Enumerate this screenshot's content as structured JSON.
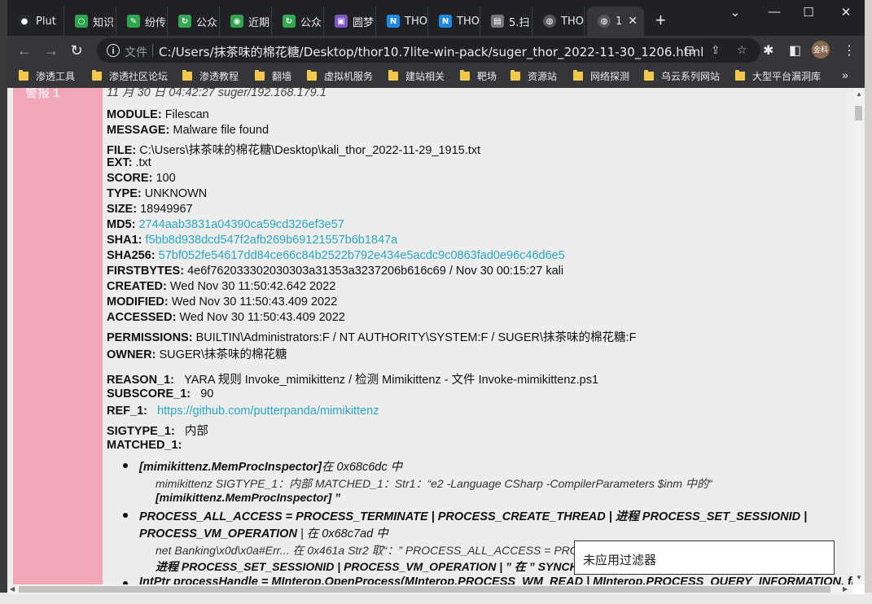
{
  "browser": {
    "tabs": [
      {
        "label": "Plut",
        "icon": "github-icon",
        "color": "#24292e"
      },
      {
        "label": "知识",
        "icon": "ring-icon",
        "color": "#2ea44f"
      },
      {
        "label": "纷传",
        "icon": "chat-icon",
        "color": "#2ea44f"
      },
      {
        "label": "公众",
        "icon": "swirl-icon",
        "color": "#34a853"
      },
      {
        "label": "近期",
        "icon": "wechat-icon",
        "color": "#2ea44f"
      },
      {
        "label": "公众",
        "icon": "swirl-icon",
        "color": "#34a853"
      },
      {
        "label": "圆梦",
        "icon": "image-icon",
        "color": "#7e57c2"
      },
      {
        "label": "THO",
        "icon": "n-icon",
        "color": "#1e88e5"
      },
      {
        "label": "THO",
        "icon": "n-icon",
        "color": "#1e88e5"
      },
      {
        "label": "5.扫",
        "icon": "doc-icon",
        "color": "#777777"
      },
      {
        "label": "THO",
        "icon": "globe-icon",
        "color": "#cccccc"
      },
      {
        "label": "1",
        "icon": "globe-icon",
        "color": "#cccccc"
      }
    ],
    "address_label": "文件",
    "url": "C:/Users/抹茶味的棉花糖/Desktop/thor10.7lite-win-pack/suger_thor_2022-11-30_1206.html",
    "avatar_text": "金科",
    "bookmarks": [
      "渗透工具",
      "渗透社区论坛",
      "渗透教程",
      "翻墙",
      "虚拟机服务",
      "建站相关",
      "靶场",
      "资源站",
      "网络探测",
      "乌云系列网站",
      "大型平台漏洞库"
    ]
  },
  "report": {
    "partial_header": "11 月 30 日 04:42:27 suger/192.168.179.1",
    "side_label": "警报 1",
    "fields": [
      {
        "k": "MODULE:",
        "v": "Filescan"
      },
      {
        "k": "MESSAGE:",
        "v": "Malware file found"
      },
      {
        "k": "FILE:",
        "v": "C:\\Users\\抹茶味的棉花糖\\Desktop\\kali_thor_2022-11-29_1915.txt"
      },
      {
        "k": "EXT:",
        "v": ".txt"
      },
      {
        "k": "SCORE:",
        "v": "100"
      },
      {
        "k": "TYPE:",
        "v": "UNKNOWN"
      },
      {
        "k": "SIZE:",
        "v": "18949967"
      },
      {
        "k": "MD5:",
        "v": "2744aab3831a04390ca59cd326ef3e57",
        "link": true
      },
      {
        "k": "SHA1:",
        "v": "f5bb8d938dcd547f2afb269b69121557b6b1847a",
        "link": true
      },
      {
        "k": "SHA256:",
        "v": "57bf052fe54617dd84ce66c84b2522b792e434e5acdc9c0863fad0e96c46d6e5",
        "link": true
      },
      {
        "k": "FIRSTBYTES:",
        "v": "4e6f762033302030303a31353a3237206b616c69 / Nov 30 00:15:27 kali"
      },
      {
        "k": "CREATED:",
        "v": "Wed Nov 30 11:50:42.642 2022"
      },
      {
        "k": "MODIFIED:",
        "v": "Wed Nov 30 11:50:43.409 2022"
      },
      {
        "k": "ACCESSED:",
        "v": "Wed Nov 30 11:50:43.409 2022"
      },
      {
        "k": "PERMISSIONS:",
        "v": "BUILTIN\\Administrators:F / NT AUTHORITY\\SYSTEM:F / SUGER\\抹茶味的棉花糖:F"
      },
      {
        "k": "OWNER:",
        "v": "SUGER\\抹茶味的棉花糖"
      }
    ],
    "reason_fields": [
      {
        "k": "REASON_1:",
        "v": "YARA 规则 Invoke_mimikittenz / 检测 Mimikittenz - 文件 Invoke-mimikittenz.ps1"
      },
      {
        "k": "SUBSCORE_1:",
        "v": "90"
      },
      {
        "k": "REF_1:",
        "v": "https://github.com/putterpanda/mimikittenz",
        "link": true
      },
      {
        "k": "SIGTYPE_1:",
        "v": "内部"
      },
      {
        "k": "MATCHED_1:",
        "v": ""
      }
    ],
    "matches": [
      {
        "head_b": "[mimikittenz.MemProcInspector]",
        "head_rest": "在 0x68c6dc 中",
        "detail1": "mimikittenz SIGTYPE_1：内部 MATCHED_1：Str1：“e2 -Language CSharp -CompilerParameters $inm 中的“",
        "detail2_b": "[mimikittenz.MemProcInspector] ”"
      },
      {
        "head_b": "PROCESS_ALL_ACCESS = PROCESS_TERMINATE | PROCESS_CREATE_THREAD | 进程 PROCESS_SET_SESSIONID |",
        "head_b2": "PROCESS_VM_OPERATION",
        "head_rest": " | 在 0x68c7ad 中",
        "detail1": "net Banking\\x0d\\x0a#Err... 在 0x461a Str2 取“：” PROCESS_ALL_ACCESS = PRO",
        "detail2_b": "进程 PROCESS_SET_SESSIONID | PROCESS_VM_OPERATION | ” 在 ” SYNCHRON"
      },
      {
        "head_b": "IntPtr processHandle = MInterop.OpenProcess(MInterop.PROCESS_WM_READ | MInterop.PROCESS_QUERY_INFORMATION, false"
      }
    ],
    "filter_tooltip": "未应用过滤器"
  }
}
